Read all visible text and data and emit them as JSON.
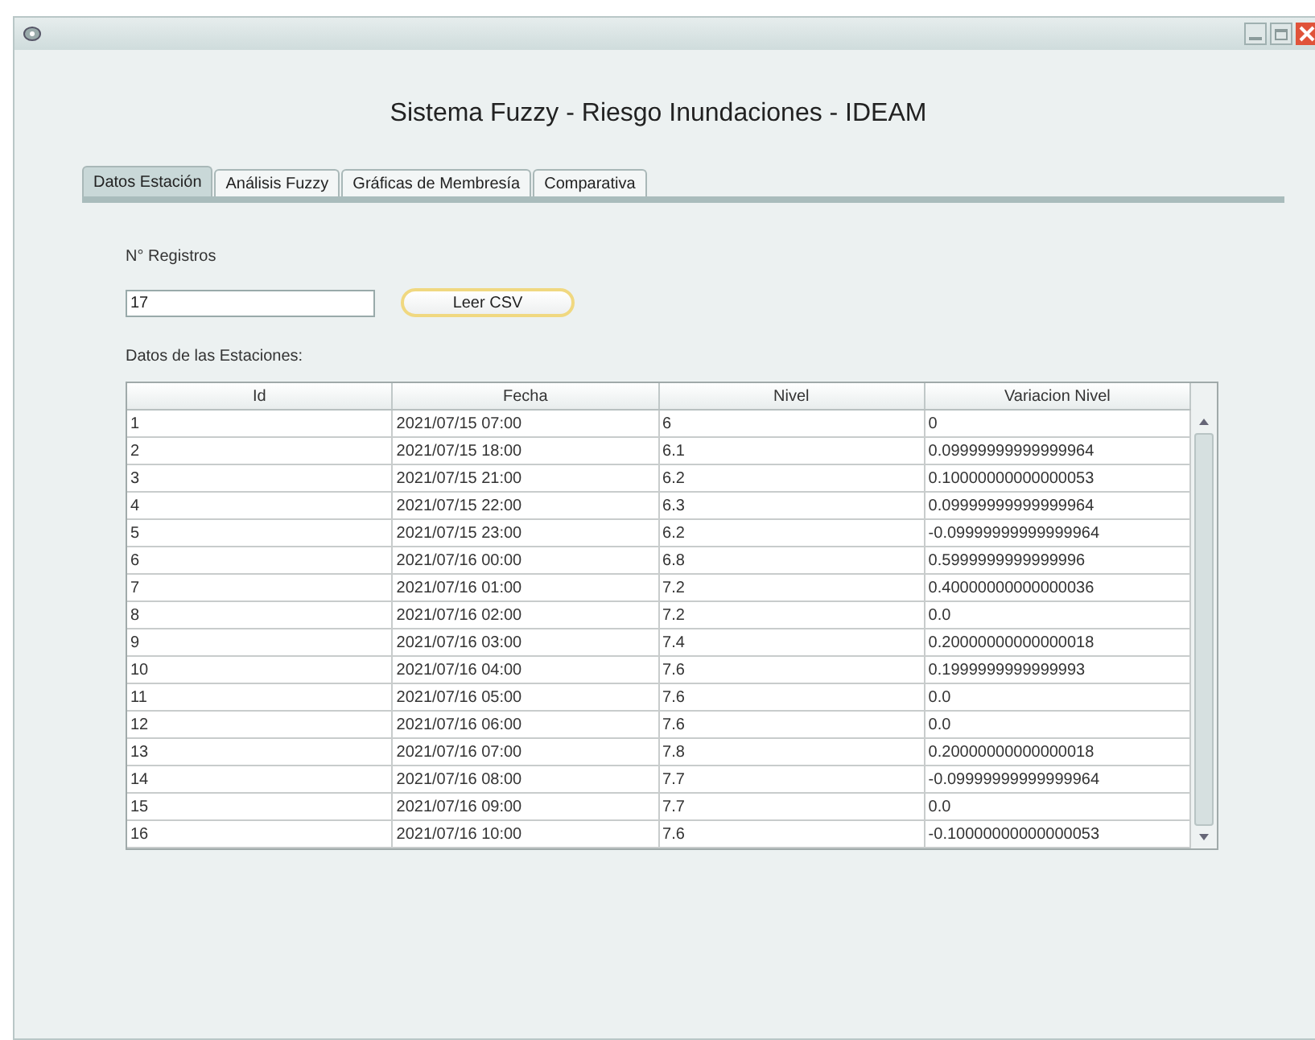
{
  "window": {
    "title_bar_buttons": [
      {
        "kind": "minimize"
      },
      {
        "kind": "maximize"
      },
      {
        "kind": "close"
      }
    ]
  },
  "heading": "Sistema Fuzzy - Riesgo Inundaciones - IDEAM",
  "tabs": [
    {
      "label": "Datos Estación",
      "selected": true
    },
    {
      "label": "Análisis Fuzzy",
      "selected": false
    },
    {
      "label": "Gráficas de Membresía",
      "selected": false
    },
    {
      "label": "Comparativa",
      "selected": false
    }
  ],
  "records": {
    "label": "N° Registros",
    "value": "17",
    "button": "Leer CSV"
  },
  "table": {
    "caption": "Datos de las Estaciones:",
    "columns": [
      "Id",
      "Fecha",
      "Nivel",
      "Variacion Nivel"
    ],
    "rows": [
      [
        "1",
        "2021/07/15 07:00",
        "6",
        "0"
      ],
      [
        "2",
        "2021/07/15 18:00",
        "6.1",
        "0.09999999999999964"
      ],
      [
        "3",
        "2021/07/15 21:00",
        "6.2",
        "0.10000000000000053"
      ],
      [
        "4",
        "2021/07/15 22:00",
        "6.3",
        "0.09999999999999964"
      ],
      [
        "5",
        "2021/07/15 23:00",
        "6.2",
        "-0.09999999999999964"
      ],
      [
        "6",
        "2021/07/16 00:00",
        "6.8",
        "0.5999999999999996"
      ],
      [
        "7",
        "2021/07/16 01:00",
        "7.2",
        "0.40000000000000036"
      ],
      [
        "8",
        "2021/07/16 02:00",
        "7.2",
        "0.0"
      ],
      [
        "9",
        "2021/07/16 03:00",
        "7.4",
        "0.20000000000000018"
      ],
      [
        "10",
        "2021/07/16 04:00",
        "7.6",
        "0.1999999999999993"
      ],
      [
        "11",
        "2021/07/16 05:00",
        "7.6",
        "0.0"
      ],
      [
        "12",
        "2021/07/16 06:00",
        "7.6",
        "0.0"
      ],
      [
        "13",
        "2021/07/16 07:00",
        "7.8",
        "0.20000000000000018"
      ],
      [
        "14",
        "2021/07/16 08:00",
        "7.7",
        "-0.09999999999999964"
      ],
      [
        "15",
        "2021/07/16 09:00",
        "7.7",
        "0.0"
      ],
      [
        "16",
        "2021/07/16 10:00",
        "7.6",
        "-0.10000000000000053"
      ]
    ]
  }
}
